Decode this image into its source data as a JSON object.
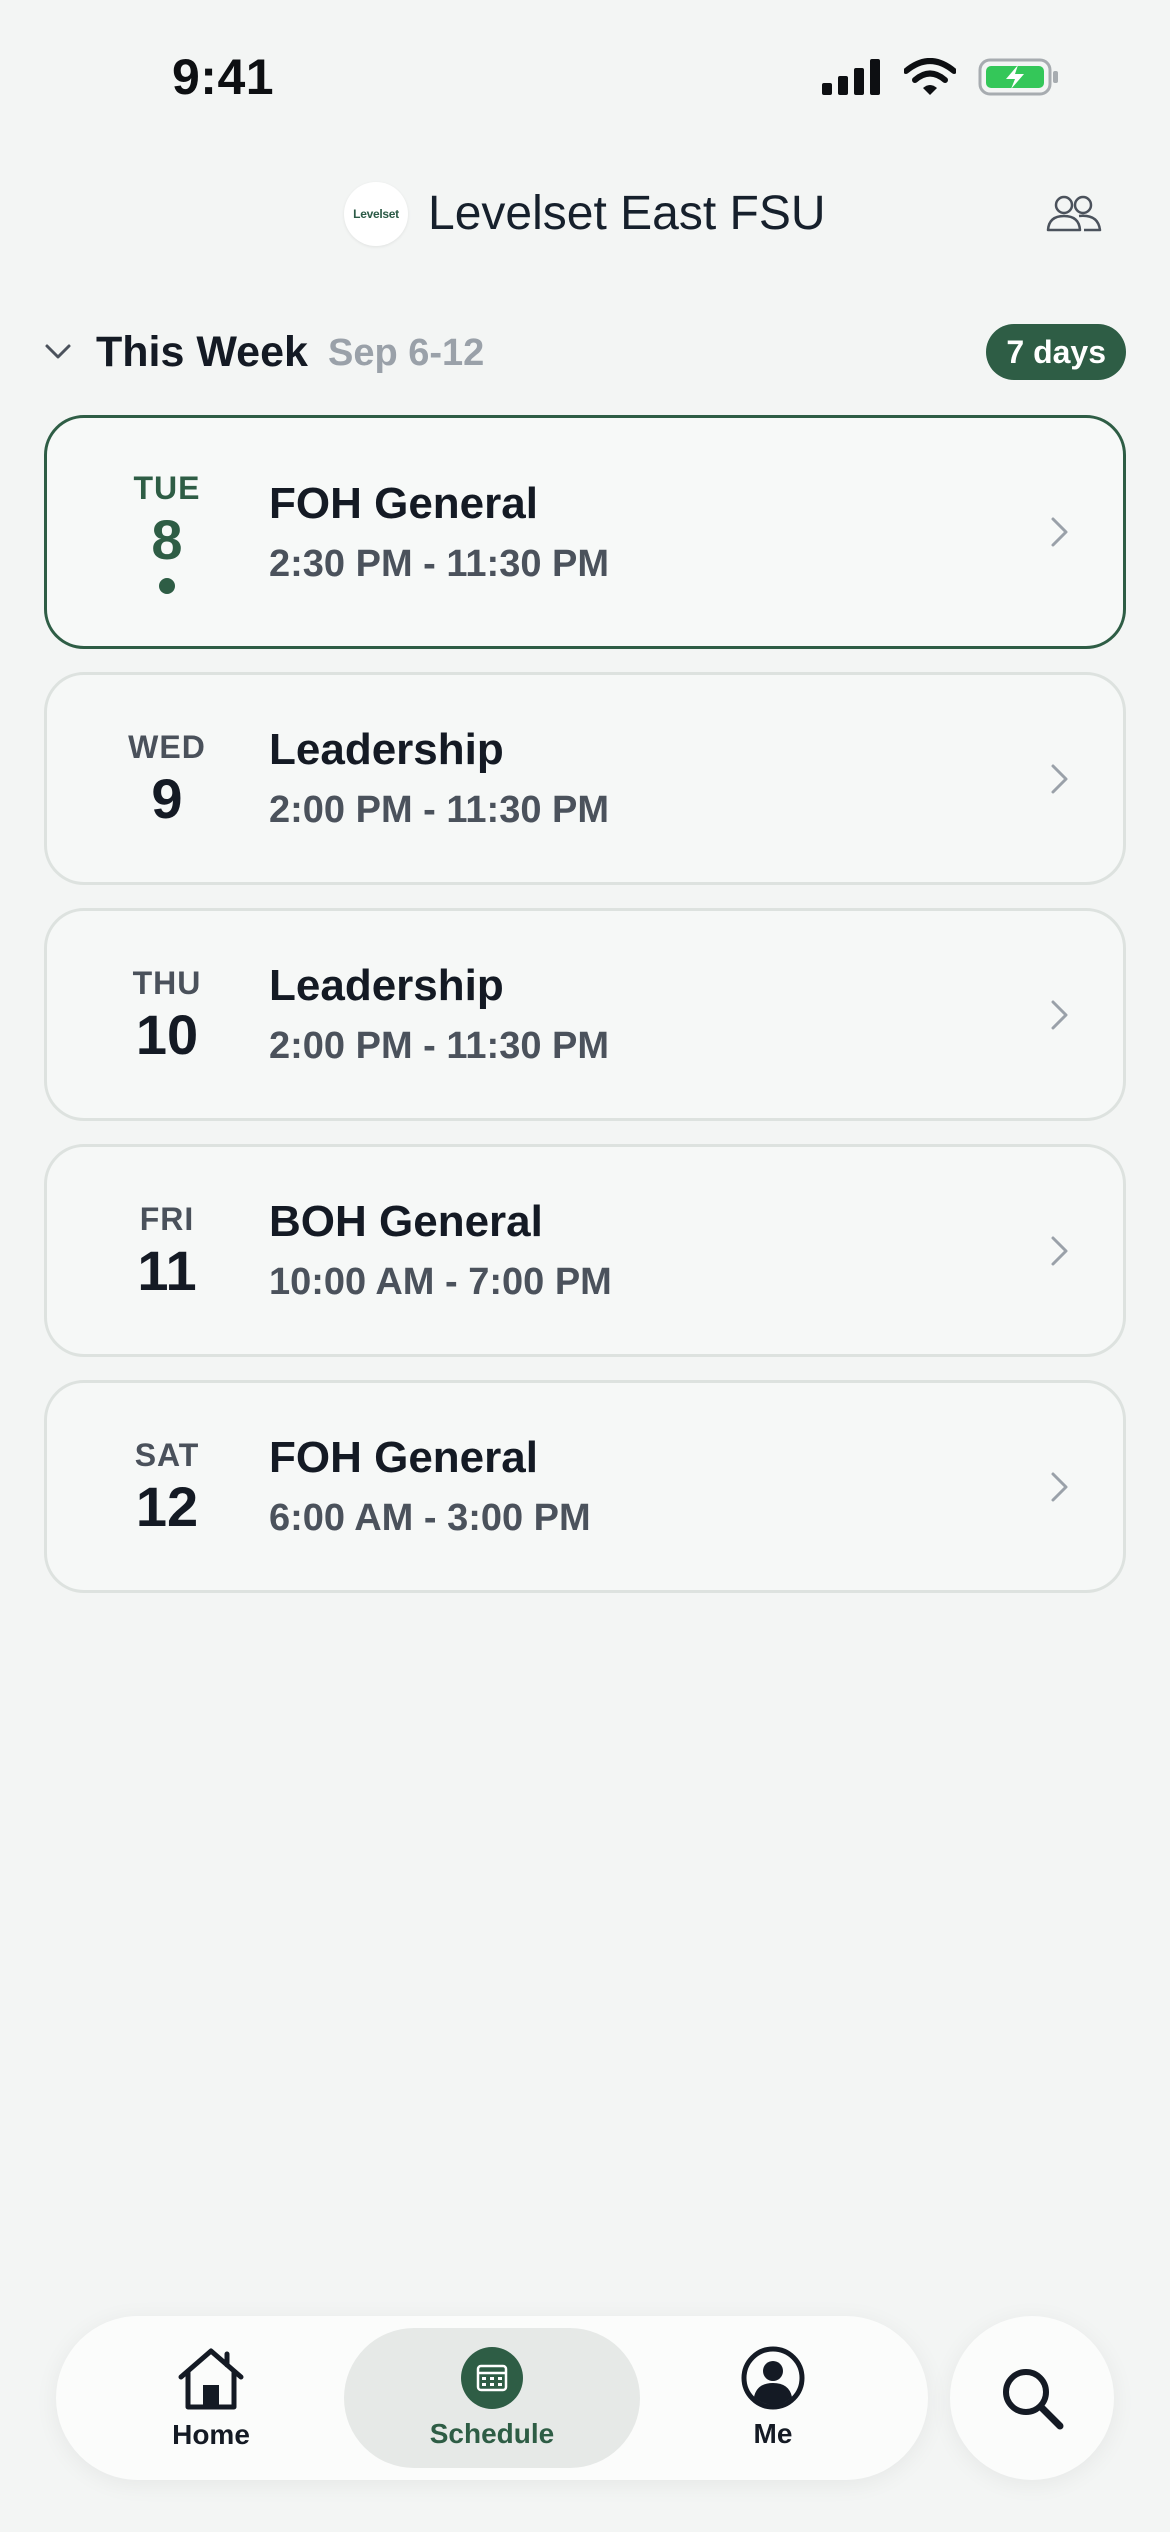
{
  "status_bar": {
    "time": "9:41"
  },
  "header": {
    "logo_text": "Levelset",
    "title": "Levelset East FSU"
  },
  "week": {
    "title": "This Week",
    "range": "Sep 6-12",
    "badge": "7 days"
  },
  "shifts": [
    {
      "day": "TUE",
      "date": "8",
      "role": "FOH General",
      "time": "2:30 PM - 11:30 PM",
      "is_today": true
    },
    {
      "day": "WED",
      "date": "9",
      "role": "Leadership",
      "time": "2:00 PM - 11:30 PM",
      "is_today": false
    },
    {
      "day": "THU",
      "date": "10",
      "role": "Leadership",
      "time": "2:00 PM - 11:30 PM",
      "is_today": false
    },
    {
      "day": "FRI",
      "date": "11",
      "role": "BOH General",
      "time": "10:00 AM - 7:00 PM",
      "is_today": false
    },
    {
      "day": "SAT",
      "date": "12",
      "role": "FOH General",
      "time": "6:00 AM - 3:00 PM",
      "is_today": false
    }
  ],
  "tabs": [
    {
      "label": "Home",
      "icon": "home-icon",
      "active": false
    },
    {
      "label": "Schedule",
      "icon": "calendar-icon",
      "active": true
    },
    {
      "label": "Me",
      "icon": "user-circle-icon",
      "active": false
    }
  ],
  "colors": {
    "accent": "#2e5d45",
    "background": "#f3f5f4",
    "battery": "#34c759"
  }
}
